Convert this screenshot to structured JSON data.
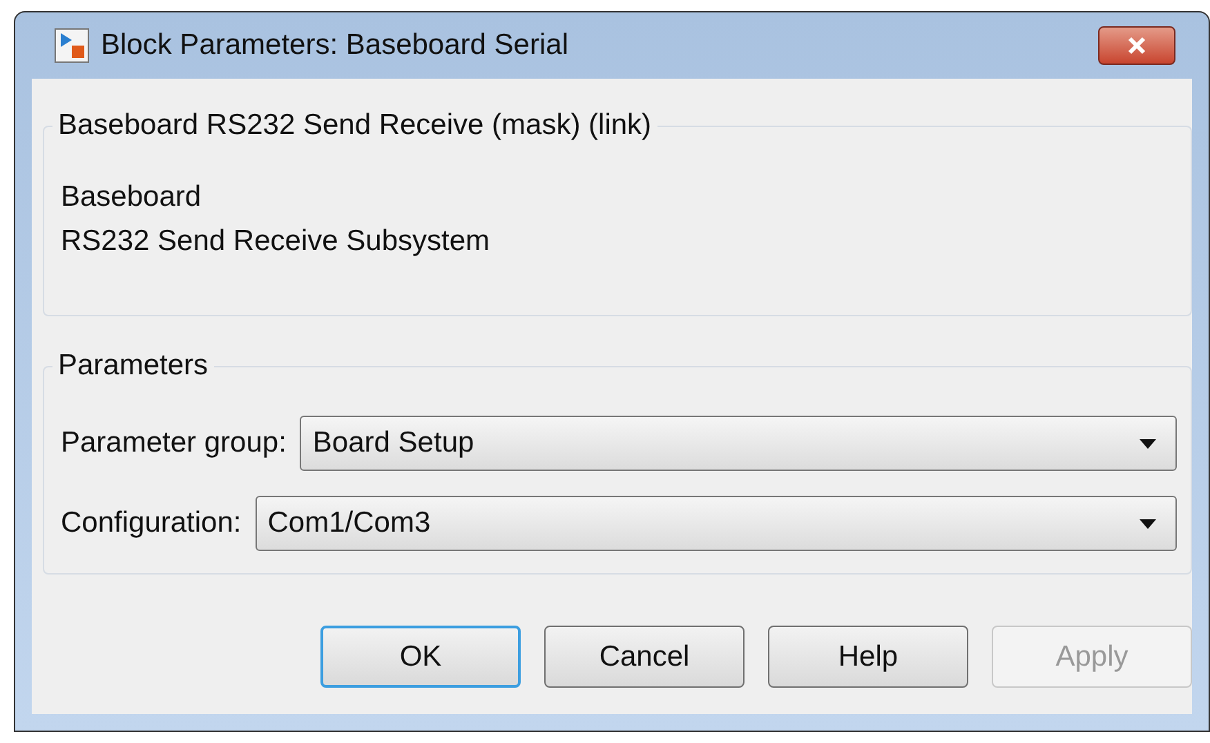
{
  "window": {
    "title": "Block Parameters: Baseboard Serial"
  },
  "mask": {
    "title": "Baseboard RS232 Send Receive (mask) (link)",
    "description_lines": [
      "Baseboard",
      "RS232 Send Receive Subsystem"
    ]
  },
  "parameters": {
    "title": "Parameters",
    "fields": [
      {
        "label": "Parameter group:",
        "value": "Board Setup"
      },
      {
        "label": "Configuration:",
        "value": "Com1/Com3"
      }
    ]
  },
  "buttons": [
    {
      "label": "OK",
      "default": true,
      "disabled": false
    },
    {
      "label": "Cancel",
      "default": false,
      "disabled": false
    },
    {
      "label": "Help",
      "default": false,
      "disabled": false
    },
    {
      "label": "Apply",
      "default": false,
      "disabled": true
    }
  ]
}
